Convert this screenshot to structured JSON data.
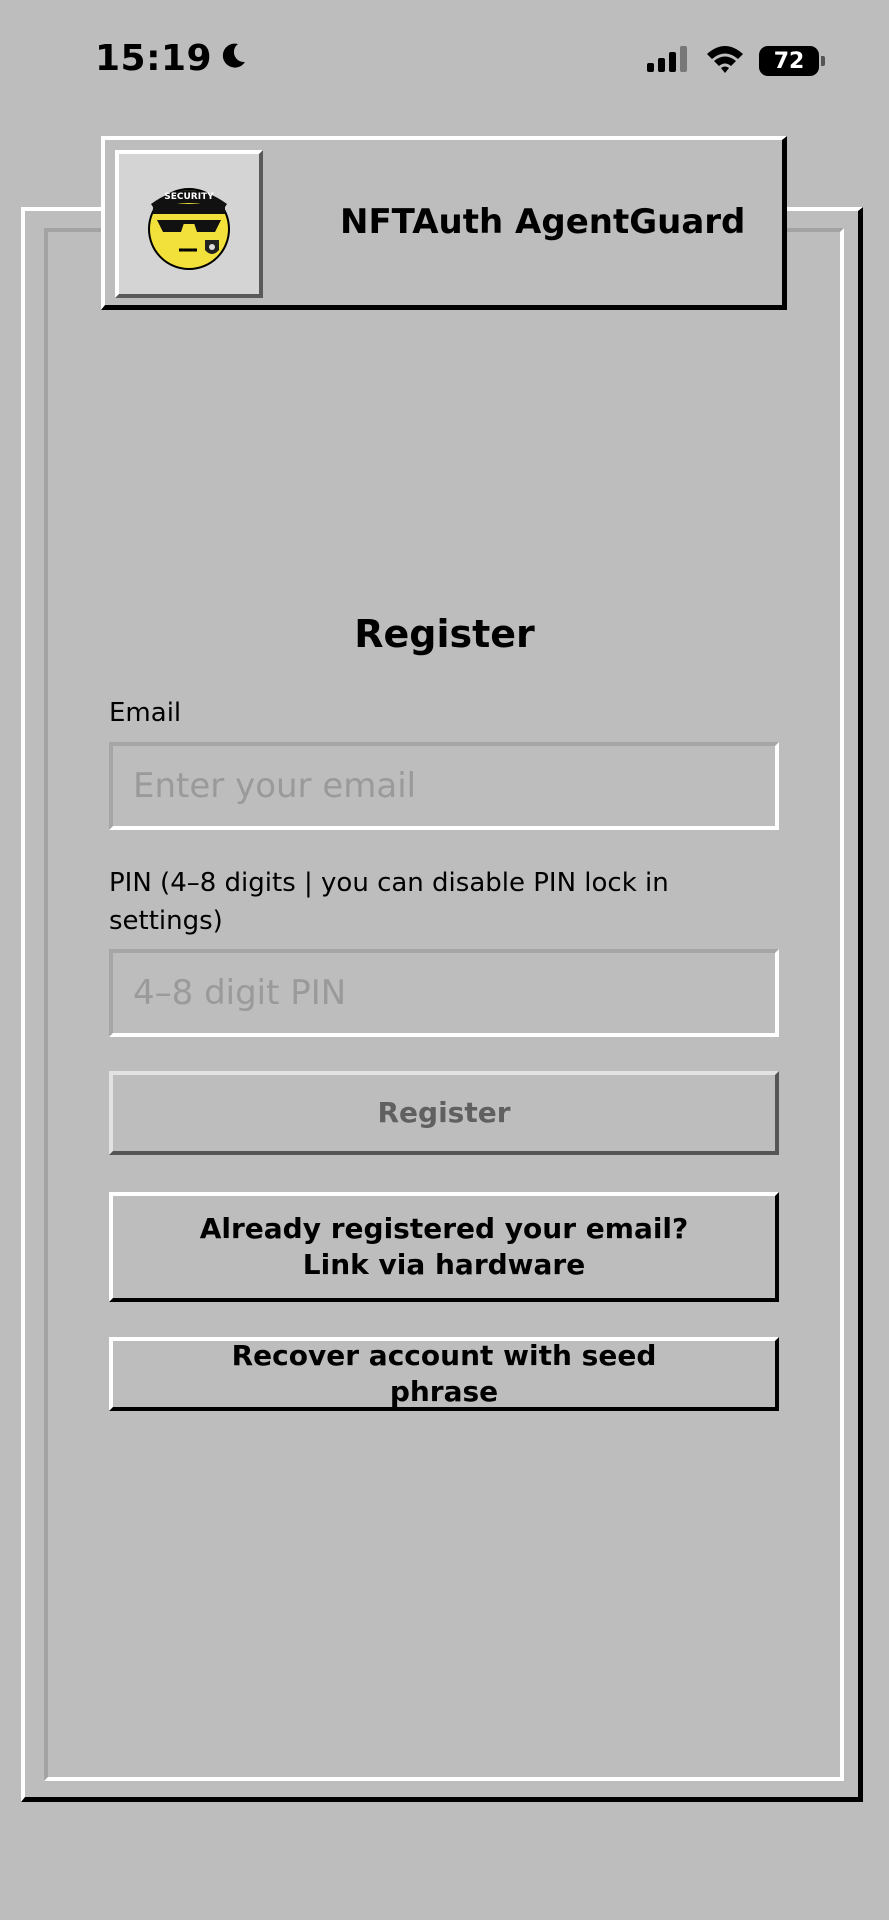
{
  "status_bar": {
    "time": "15:19",
    "battery": "72"
  },
  "header": {
    "logo_text": "SECURITY",
    "title": "NFTAuth AgentGuard"
  },
  "form": {
    "title": "Register",
    "email_label": "Email",
    "email_placeholder": "Enter your email",
    "email_value": "",
    "pin_label": "PIN (4–8 digits | you can disable PIN lock in settings)",
    "pin_placeholder": "4–8 digit PIN",
    "pin_value": "",
    "register_label": "Register",
    "link_hardware_label": "Already registered your email? Link via hardware",
    "recover_label": "Recover account with seed phrase"
  },
  "colors": {
    "background": "#bdbdbd",
    "logo_face": "#f2e13a",
    "disabled_text": "#606060"
  }
}
